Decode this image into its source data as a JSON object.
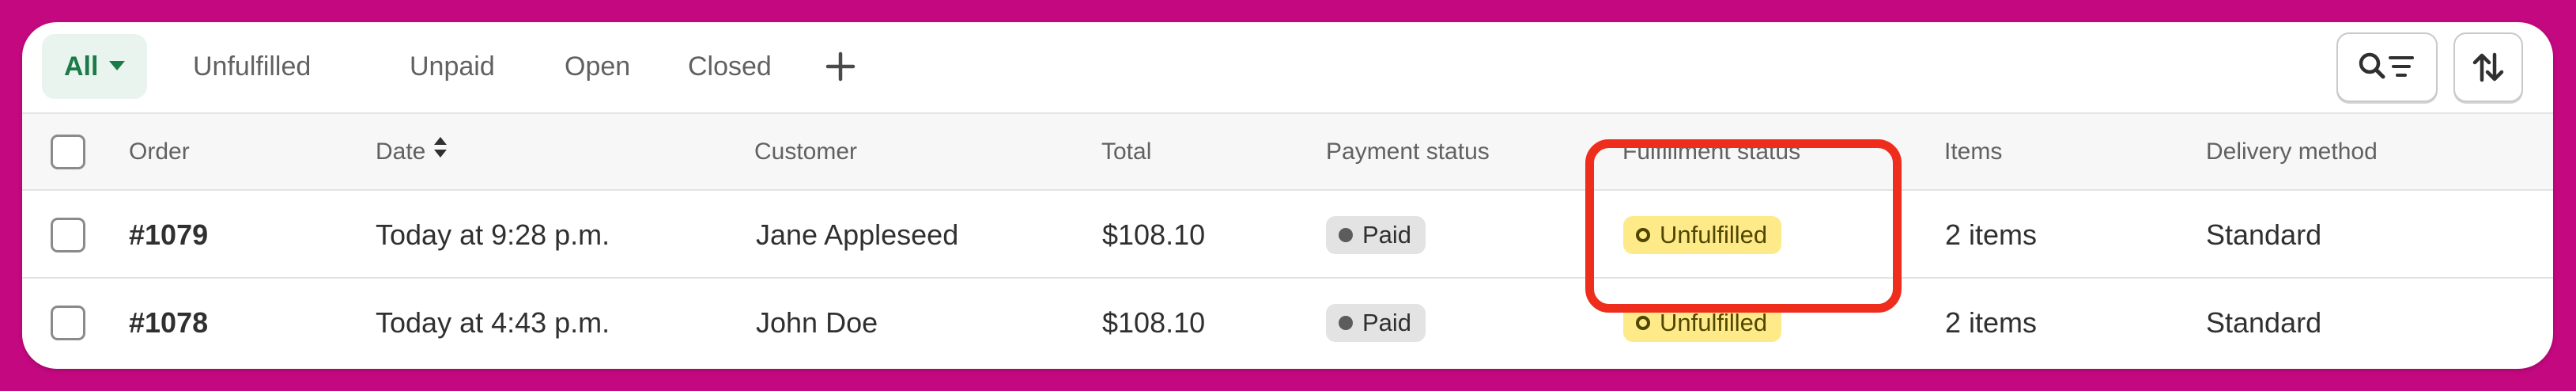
{
  "tabs": [
    {
      "label": "All",
      "active": true
    },
    {
      "label": "Unfulfilled",
      "active": false
    },
    {
      "label": "Unpaid",
      "active": false
    },
    {
      "label": "Open",
      "active": false
    },
    {
      "label": "Closed",
      "active": false
    }
  ],
  "icons": {
    "add_tab": "plus-icon",
    "search_filter": "search-filter-icon",
    "sort": "sort-arrows-icon",
    "date_sort": "sort-caret-icon"
  },
  "columns": {
    "order": "Order",
    "date": "Date",
    "customer": "Customer",
    "total": "Total",
    "payment_status": "Payment status",
    "fulfillment_status": "Fulfillment status",
    "items": "Items",
    "delivery_method": "Delivery method"
  },
  "orders": [
    {
      "order": "#1079",
      "date": "Today at 9:28 p.m.",
      "customer": "Jane Appleseed",
      "total": "$108.10",
      "payment_status": "Paid",
      "fulfillment_status": "Unfulfilled",
      "items": "2 items",
      "delivery_method": "Standard"
    },
    {
      "order": "#1078",
      "date": "Today at 4:43 p.m.",
      "customer": "John Doe",
      "total": "$108.10",
      "payment_status": "Paid",
      "fulfillment_status": "Unfulfilled",
      "items": "2 items",
      "delivery_method": "Standard"
    }
  ],
  "colors": {
    "background": "#c4087f",
    "active_tab_bg": "#eaf4ee",
    "active_tab_text": "#1a7a48",
    "paid_badge": "#e3e3e3",
    "unfulfilled_badge": "#ffea8a",
    "highlight": "#ef2d1c"
  }
}
